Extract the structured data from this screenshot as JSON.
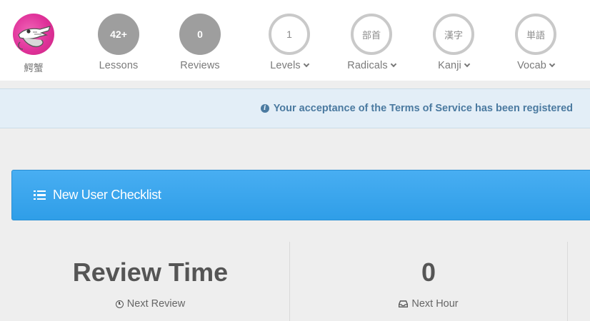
{
  "nav": {
    "user": {
      "name": "鰐蟹"
    },
    "lessons": {
      "count": "42+",
      "label": "Lessons"
    },
    "reviews": {
      "count": "0",
      "label": "Reviews"
    },
    "levels": {
      "value": "1",
      "label": "Levels"
    },
    "radicals": {
      "value": "部首",
      "label": "Radicals"
    },
    "kanji": {
      "value": "漢字",
      "label": "Kanji"
    },
    "vocab": {
      "value": "単語",
      "label": "Vocab"
    }
  },
  "alert": {
    "icon": "info-icon",
    "message": "Your acceptance of the Terms of Service has been registered"
  },
  "checklist": {
    "icon": "list-icon",
    "title": "New User Checklist"
  },
  "stats": {
    "review_time": {
      "value": "Review Time",
      "label": "Next Review",
      "icon": "clock-icon"
    },
    "next_hour": {
      "value": "0",
      "label": "Next Hour",
      "icon": "inbox-icon"
    }
  },
  "colors": {
    "avatar_bg": "#e0329a",
    "filled_circle": "#9e9e9e",
    "alert_bg": "#e3eef7",
    "alert_text": "#4b7aa0",
    "checklist_bg": "#3aa6ee"
  }
}
